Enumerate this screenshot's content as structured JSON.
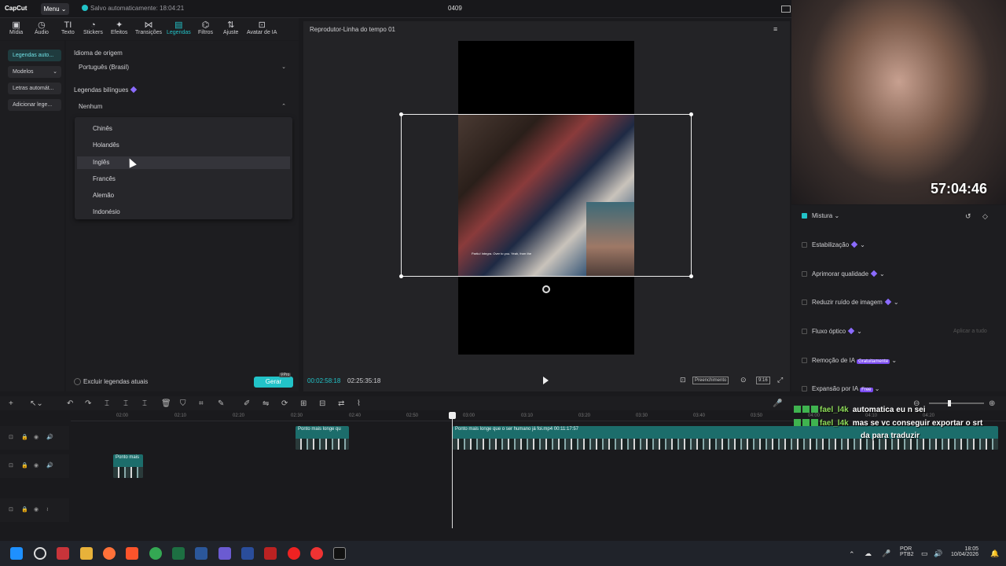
{
  "app": {
    "logo": "CapCut",
    "menu_label": "Menu",
    "autosave": "Salvo automaticamente: 18:04:21",
    "project": "0409"
  },
  "toolbar": [
    {
      "label": "Mídia",
      "icon": "▣"
    },
    {
      "label": "Áudio",
      "icon": "◷"
    },
    {
      "label": "Texto",
      "icon": "TI"
    },
    {
      "label": "Stickers",
      "icon": "◔"
    },
    {
      "label": "Efeitos",
      "icon": "✦"
    },
    {
      "label": "Transições",
      "icon": "⋈"
    },
    {
      "label": "Legendas",
      "icon": "▤"
    },
    {
      "label": "Filtros",
      "icon": "⌬"
    },
    {
      "label": "Ajuste",
      "icon": "⇅"
    },
    {
      "label": "Avatar de IA",
      "icon": "⊡"
    }
  ],
  "leftnav": [
    "Legendas auto...",
    "Modelos",
    "Letras automát...",
    "Adicionar lege..."
  ],
  "panel": {
    "source_label": "Idioma de origem",
    "source_value": "Português (Brasil)",
    "bilingual_label": "Legendas bilíngues",
    "bilingual_value": "Nenhum",
    "options": [
      "Chinês",
      "Holandês",
      "Inglês",
      "Francês",
      "Alemão",
      "Indonésio"
    ],
    "exclude_label": "Excluir legendas atuais",
    "generate_label": "Gerar",
    "pro_badge": "Pro"
  },
  "player": {
    "title": "Reprodutor-Linha do tempo 01",
    "current": "00:02:58:18",
    "total": "02:25:35:18",
    "fill_label": "Preenchimento",
    "ratio": "9:16",
    "video_subtitle": "Partiu! Integra. Over to you. Yeah, from the"
  },
  "webcam": {
    "timer": "57:04:46"
  },
  "props": [
    {
      "label": "Mistura",
      "checked": true,
      "tag": ""
    },
    {
      "label": "Estabilização",
      "checked": false,
      "tag": ""
    },
    {
      "label": "Aprimorar qualidade",
      "checked": false,
      "tag": ""
    },
    {
      "label": "Reduzir ruído de imagem",
      "checked": false,
      "tag": ""
    },
    {
      "label": "Fluxo óptico",
      "checked": false,
      "tag": ""
    },
    {
      "label": "Remoção de IA",
      "checked": false,
      "tag": "Gratuitamente"
    },
    {
      "label": "Expansão por IA",
      "checked": false,
      "tag": "Free"
    }
  ],
  "props_apply_all": "Aplicar a tudo",
  "timeline": {
    "ticks": [
      "02:00",
      "02:10",
      "02:20",
      "02:30",
      "02:40",
      "02:50",
      "03:00",
      "03:10",
      "03:20",
      "03:30",
      "03:40",
      "03:50",
      "04:00",
      "04:10",
      "04:20"
    ],
    "clip_main": "Ponto mais longe que o ser humano já foi.mp4   00:11:17:57",
    "clip_small1": "Ponto mais longe qu",
    "clip_small2": "Ponto mais"
  },
  "chat": [
    {
      "user": "fael_l4k",
      "msg": "automatica eu n sei"
    },
    {
      "user": "fael_l4k",
      "msg": "mas se vc conseguir exportar o srt"
    },
    {
      "user": "",
      "msg": "da para traduzir"
    }
  ],
  "taskbar": {
    "lang": "POR",
    "kbd": "PTB2",
    "time": "18:05",
    "date": "10/04/2026"
  },
  "colors": {
    "accent": "#22c3c8",
    "bg": "#1a1a1d"
  }
}
